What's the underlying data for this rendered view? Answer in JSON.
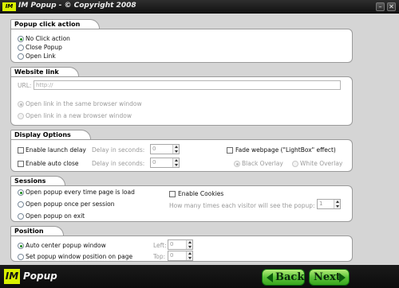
{
  "window": {
    "logo_text": "IM",
    "title": "IM Popup - © Copyright 2008"
  },
  "sections": {
    "popup_click": {
      "title": "Popup click action",
      "options": [
        "No Click action",
        "Close Popup",
        "Open Link"
      ],
      "selected": "No Click action"
    },
    "website_link": {
      "title": "Website link",
      "url_label": "URL:",
      "url_value": "http://",
      "options": [
        "Open link in the same browser window",
        "Open link in a new browser window"
      ]
    },
    "display": {
      "title": "Display Options",
      "launch_delay_label": "Enable launch delay",
      "auto_close_label": "Enable auto close",
      "delay_label": "Delay in seconds:",
      "launch_delay_value": "0",
      "auto_close_value": "0",
      "fade_label": "Fade webpage (\"LightBox\" effect)",
      "overlay_options": [
        "Black Overlay",
        "White Overlay"
      ]
    },
    "sessions": {
      "title": "Sessions",
      "options": [
        "Open popup every time page is load",
        "Open popup once per session",
        "Open popup on exit"
      ],
      "selected": "Open popup every time page is load",
      "cookies_label": "Enable Cookies",
      "times_label": "How many times each visitor will see the popup:",
      "times_value": "1"
    },
    "position": {
      "title": "Position",
      "options": [
        "Auto center popup window",
        "Set popup window position on page"
      ],
      "selected": "Auto center popup window",
      "left_label": "Left:",
      "top_label": "Top:",
      "left_value": "0",
      "top_value": "0"
    }
  },
  "footer": {
    "brand_im": "IM",
    "brand_popup": "Popup",
    "back_label": "Back",
    "next_label": "Next"
  },
  "colors": {
    "accent_green": "#39a51d",
    "brand_yellow": "#d9f000",
    "frame_dark": "#1e1e1e"
  }
}
